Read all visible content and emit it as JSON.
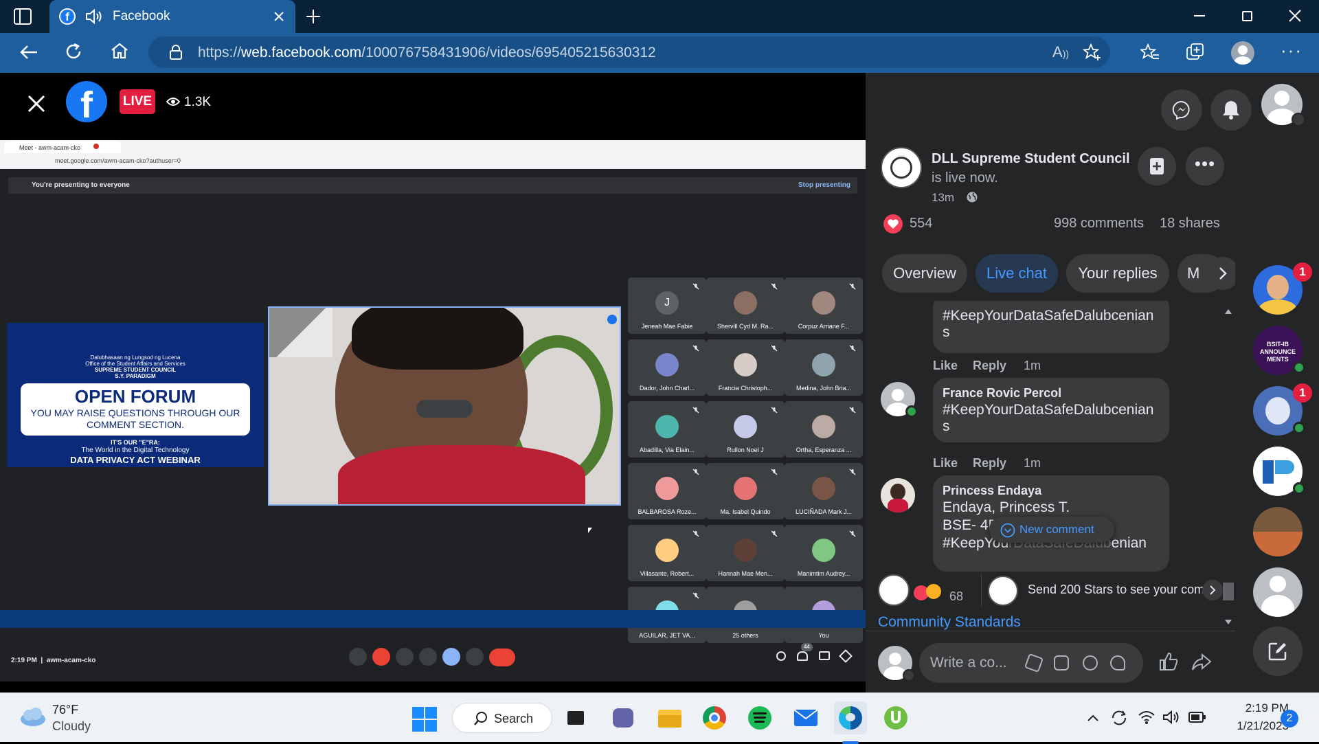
{
  "browser": {
    "tab_title": "Facebook",
    "url_prefix": "https://",
    "url_domain": "web.facebook.com",
    "url_path": "/100076758431906/videos/695405215630312"
  },
  "video": {
    "live_label": "LIVE",
    "viewer_count": "1.3K"
  },
  "meet": {
    "tab_title": "Meet - awm-acam-cko",
    "url": "meet.google.com/awm-acam-cko?authuser=0",
    "presenting_banner": "You're presenting to everyone",
    "stop_presenting": "Stop presenting",
    "time_code": "2:19 PM",
    "meeting_code": "awm-acam-cko",
    "people_count": "44",
    "participants": [
      "Jeneah Mae Fabie",
      "Shervill Cyd M. Ra...",
      "Corpuz Arriane F...",
      "Dador, John Charl...",
      "Francia Christoph...",
      "Medina, John Bria...",
      "Abadilla, Via Elain...",
      "Rullon Noel J",
      "Ortha, Esperanza ...",
      "BALBAROSA Roze...",
      "Ma. Isabel Quindo",
      "LUCIÑADA Mark J...",
      "Villasante, Robert...",
      "Hannah Mae Men...",
      "Manimtim Audrey...",
      "AGUILAR, JET VA...",
      "25 others",
      "You"
    ],
    "avatar_letter": "J"
  },
  "slide": {
    "org_line1": "Dalubhasaan ng Lungsod ng Lucena",
    "org_line2": "Office of the Student Affairs and Services",
    "org_line3": "SUPREME STUDENT COUNCIL",
    "org_line4": "S.Y. PARADIGM",
    "heading": "OPEN FORUM",
    "subtext": "YOU MAY RAISE QUESTIONS THROUGH OUR COMMENT SECTION.",
    "tagline": "IT'S OUR \"E\"RA:",
    "tagline2": "The World in the Digital Technology",
    "event": "DATA PRIVACY ACT WEBINAR"
  },
  "post": {
    "page_name": "DLL Supreme Student Council",
    "status": "is live now.",
    "time_ago": "13m",
    "reactions": "554",
    "comments": "998 comments",
    "shares": "18 shares"
  },
  "tabs": [
    {
      "label": "Overview"
    },
    {
      "label": "Live chat"
    },
    {
      "label": "Your replies"
    },
    {
      "label": "M"
    }
  ],
  "comments": [
    {
      "name": "",
      "text_line1": "#KeepYourDataSafeDalubcenian",
      "text_line2": "s",
      "like": "Like",
      "reply": "Reply",
      "time": "1m"
    },
    {
      "name": "France Rovic Percol",
      "text_line1": "#KeepYourDataSafeDalubcenian",
      "text_line2": "s",
      "like": "Like",
      "reply": "Reply",
      "time": "1m"
    },
    {
      "name": "Princess Endaya",
      "text_line1": "Endaya, Princess T.",
      "text_line2": "BSE- 4B",
      "text_line3": "#KeepYou",
      "text_line3_tail": "enian"
    }
  ],
  "new_comment_label": "New comment",
  "stars": {
    "reaction_count": "68",
    "send_stars_text": "Send 200 Stars to see your com"
  },
  "community_standards": "Community Standards",
  "compose": {
    "placeholder": "Write a co..."
  },
  "rail": {
    "badges": [
      "1",
      "1"
    ],
    "announcement_label": "BSIT-IB ANNOUNCE MENTS"
  },
  "taskbar": {
    "temperature": "76°F",
    "condition": "Cloudy",
    "search_label": "Search",
    "time": "2:19 PM",
    "date": "1/21/2023",
    "notification_count": "2"
  }
}
